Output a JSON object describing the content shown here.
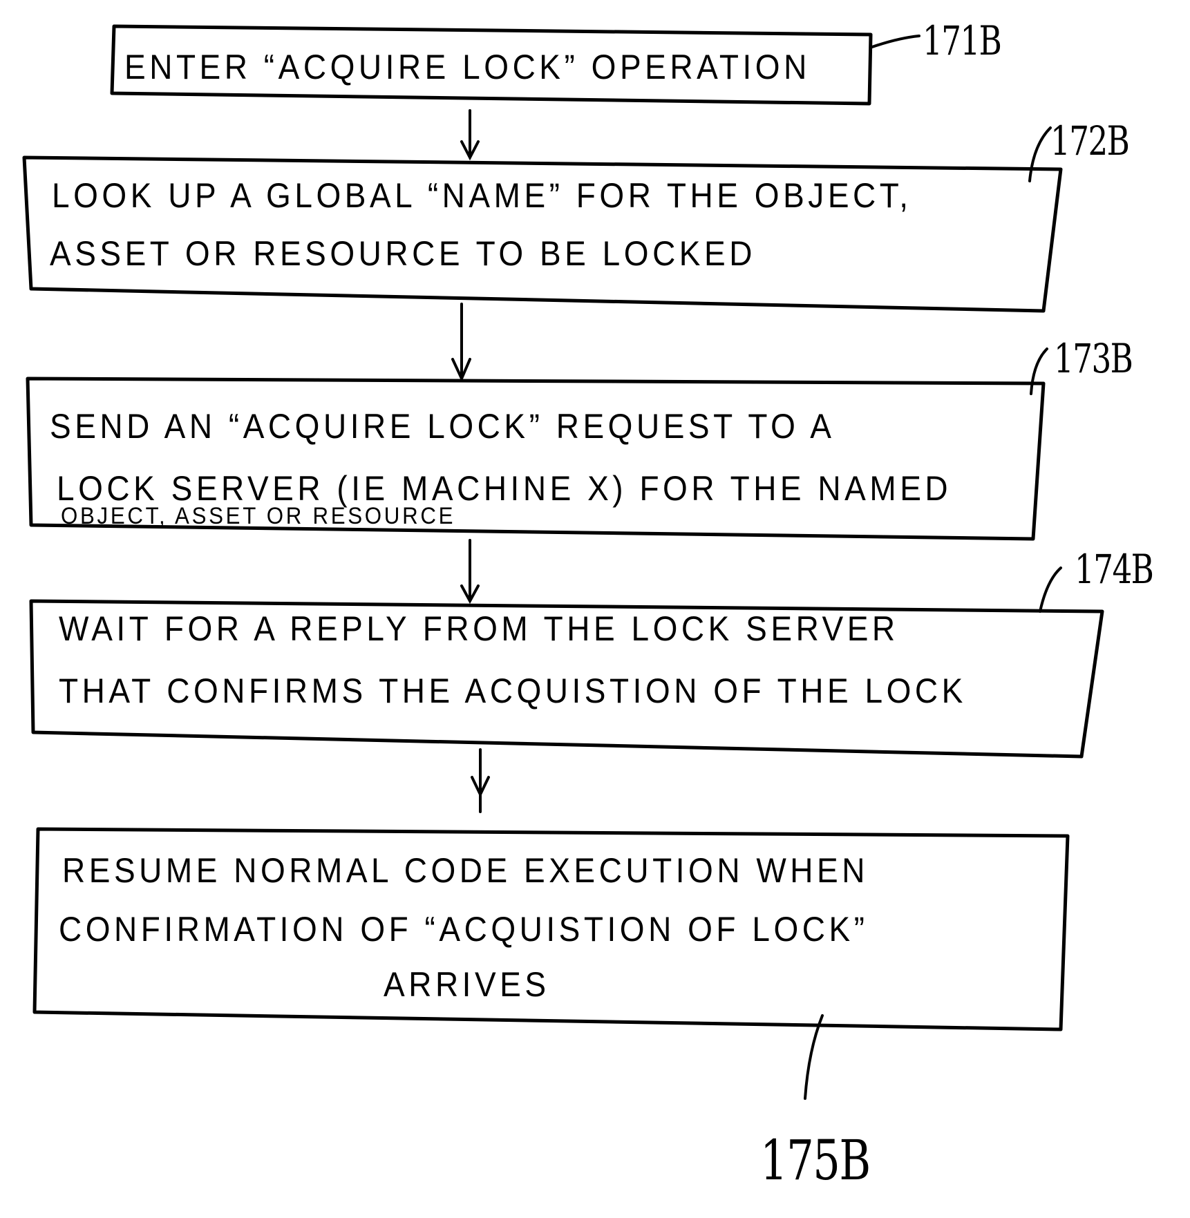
{
  "diagram": {
    "type": "flowchart",
    "steps": [
      {
        "ref": "171B",
        "lines": [
          "ENTER “ACQUIRE LOCK” OPERATION"
        ]
      },
      {
        "ref": "172B",
        "lines": [
          "LOOK UP  A  GLOBAL “NAME”  FOR THE  OBJECT,",
          "ASSET  OR   RESOURCE  TO  BE  LOCKED"
        ]
      },
      {
        "ref": "173B",
        "lines": [
          "SEND  AN  “ACQUIRE  LOCK”  REQUEST  TO   A",
          "LOCK  SERVER  (IE  MACHINE  X)  FOR THE NAMED",
          "OBJECT, ASSET OR  RESOURCE"
        ]
      },
      {
        "ref": "174B",
        "lines": [
          "WAIT   FOR  A  REPLY  FROM  THE  LOCK  SERVER",
          "THAT   CONFIRMS   THE  ACQUISTION  OF  THE  LOCK"
        ]
      },
      {
        "ref": "175B",
        "lines": [
          "RESUME   NORMAL   CODE   EXECUTION   WHEN",
          "CONFIRMATION   OF  “ACQUISTION  OF LOCK”",
          "ARRIVES"
        ]
      }
    ],
    "edges": [
      [
        "171B",
        "172B"
      ],
      [
        "172B",
        "173B"
      ],
      [
        "173B",
        "174B"
      ],
      [
        "174B",
        "175B"
      ]
    ]
  }
}
